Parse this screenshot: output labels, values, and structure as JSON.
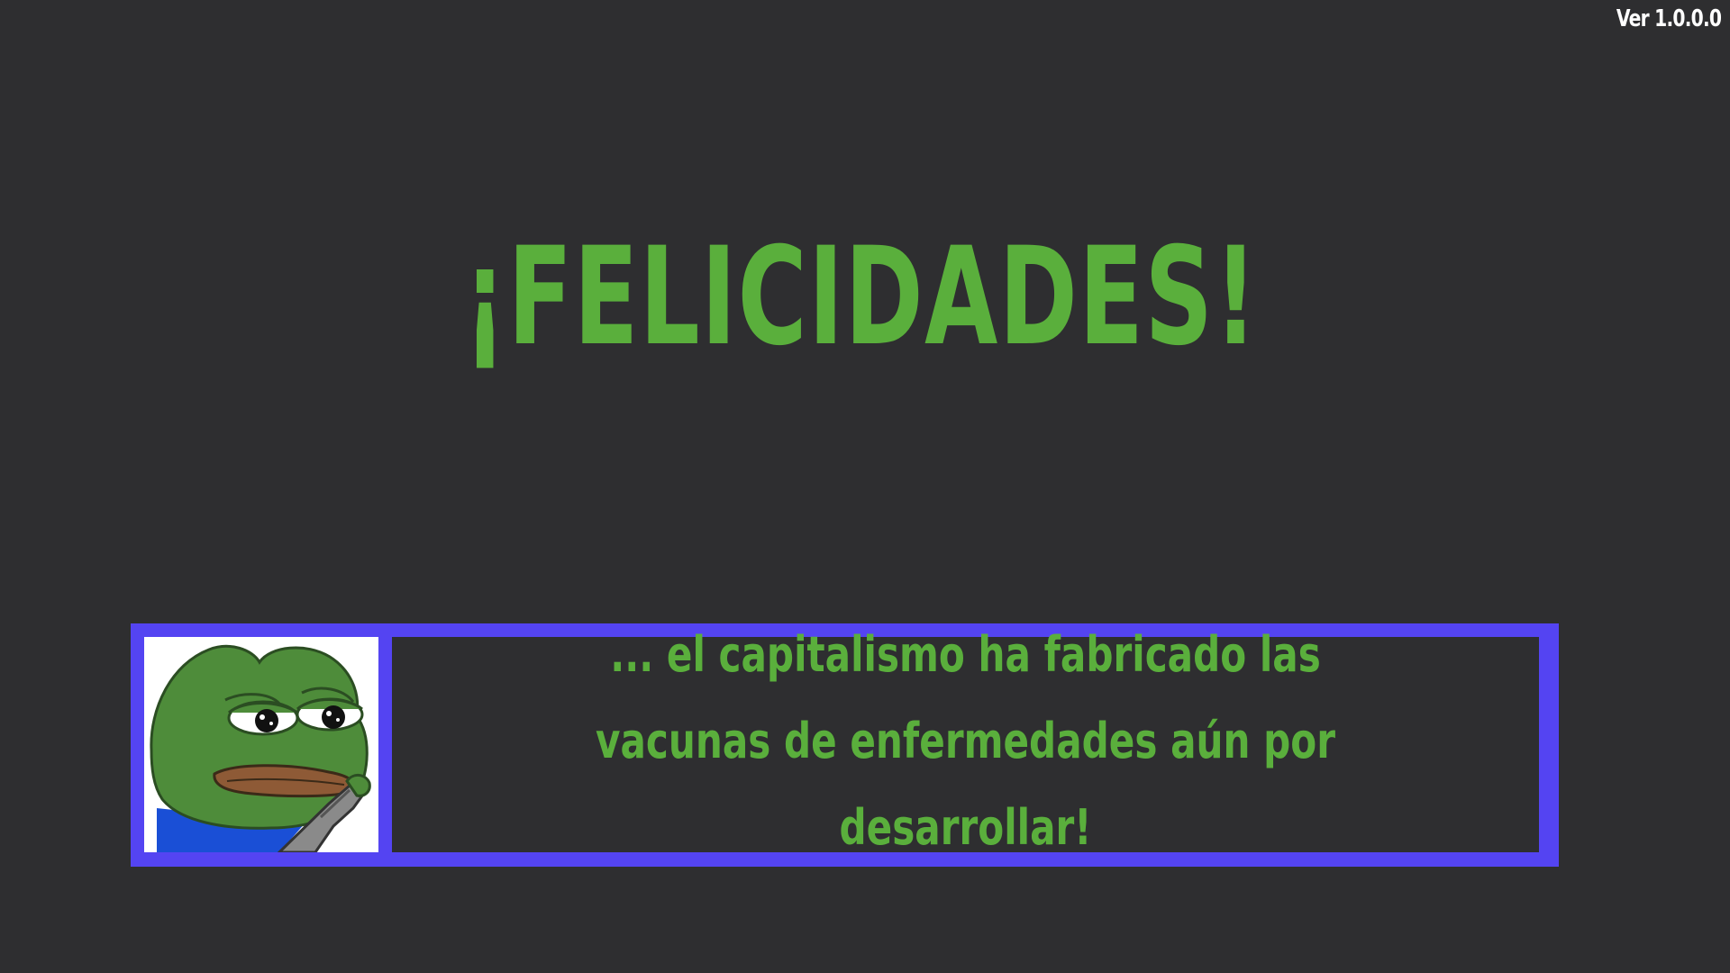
{
  "version": "Ver 1.0.0.0",
  "title": "¡FELICIDADES!",
  "dialog": {
    "portrait_icon": "sad-frog-icon",
    "message": "... el capitalismo ha fabricado las vacunas de enfermedades aún por desarrollar!"
  },
  "colors": {
    "background": "#2e2e30",
    "text_green": "#5aaf3c",
    "dialog_border": "#5444f2"
  }
}
